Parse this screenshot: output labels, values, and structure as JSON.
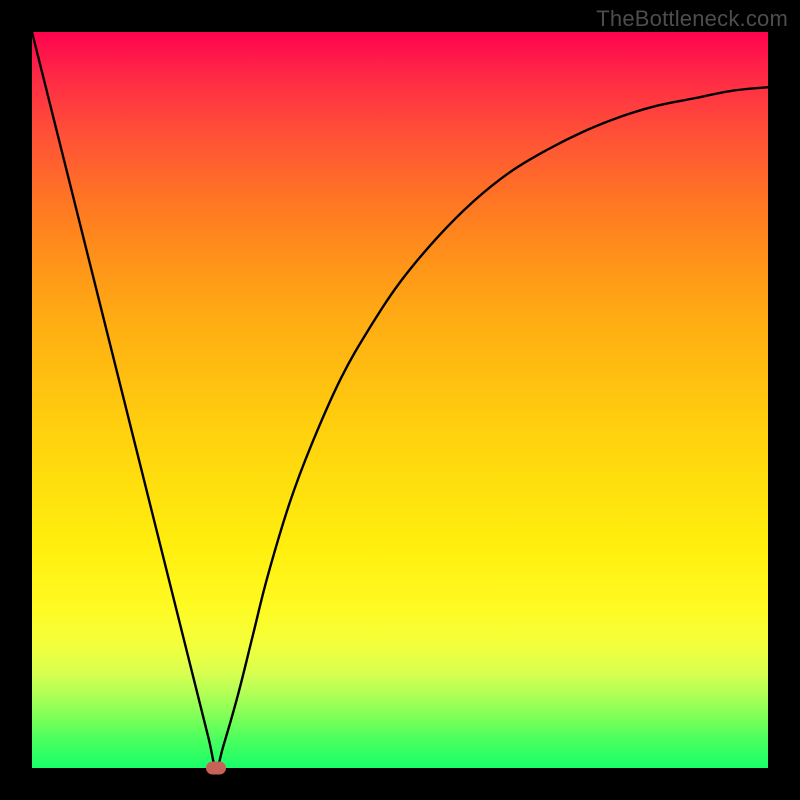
{
  "watermark": "TheBottleneck.com",
  "colors": {
    "background": "#000000",
    "gradient_top": "#ff034e",
    "gradient_bottom": "#18ff6a",
    "curve": "#000000",
    "marker": "#c76258"
  },
  "chart_data": {
    "type": "line",
    "title": "",
    "xlabel": "",
    "ylabel": "",
    "xlim": [
      0,
      100
    ],
    "ylim": [
      0,
      100
    ],
    "grid": false,
    "legend": false,
    "series": [
      {
        "name": "bottleneck-curve",
        "x": [
          0,
          2,
          4,
          6,
          8,
          10,
          12,
          14,
          16,
          18,
          20,
          22,
          24,
          25,
          26,
          28,
          30,
          32,
          35,
          38,
          42,
          46,
          50,
          55,
          60,
          65,
          70,
          75,
          80,
          85,
          90,
          95,
          100
        ],
        "y": [
          100,
          92,
          84,
          76,
          68,
          60,
          52,
          44,
          36,
          28,
          20,
          12,
          4,
          0,
          3,
          10,
          18,
          26,
          36,
          44,
          53,
          60,
          66,
          72,
          77,
          81,
          84,
          86.5,
          88.5,
          90,
          91,
          92,
          92.5
        ]
      }
    ],
    "annotations": [
      {
        "name": "optimum-marker",
        "x": 25,
        "y": 0
      }
    ]
  }
}
